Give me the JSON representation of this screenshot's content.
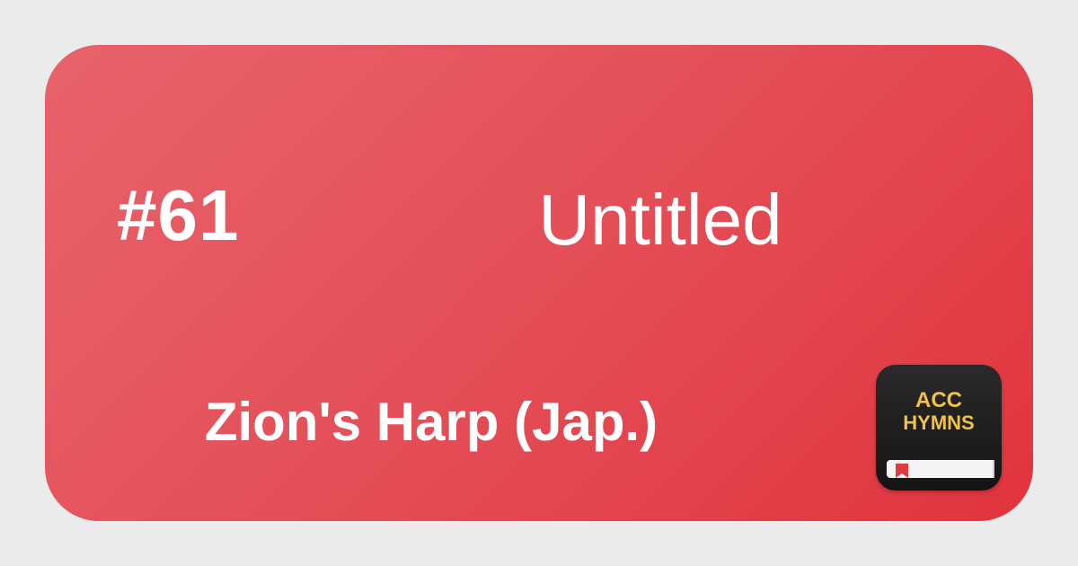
{
  "hymn": {
    "number": "#61",
    "title": "Untitled",
    "book": "Zion's Harp (Jap.)"
  },
  "logo": {
    "line1": "ACC",
    "line2": "HYMNS",
    "icon": "book-icon"
  },
  "colors": {
    "background": "#ebebeb",
    "card_gradient_start": "#e8636b",
    "card_gradient_end": "#e1343d",
    "text": "#ffffff",
    "logo_background": "#1e1e1e",
    "logo_text": "#f0c24a",
    "ribbon": "#e23a43"
  }
}
